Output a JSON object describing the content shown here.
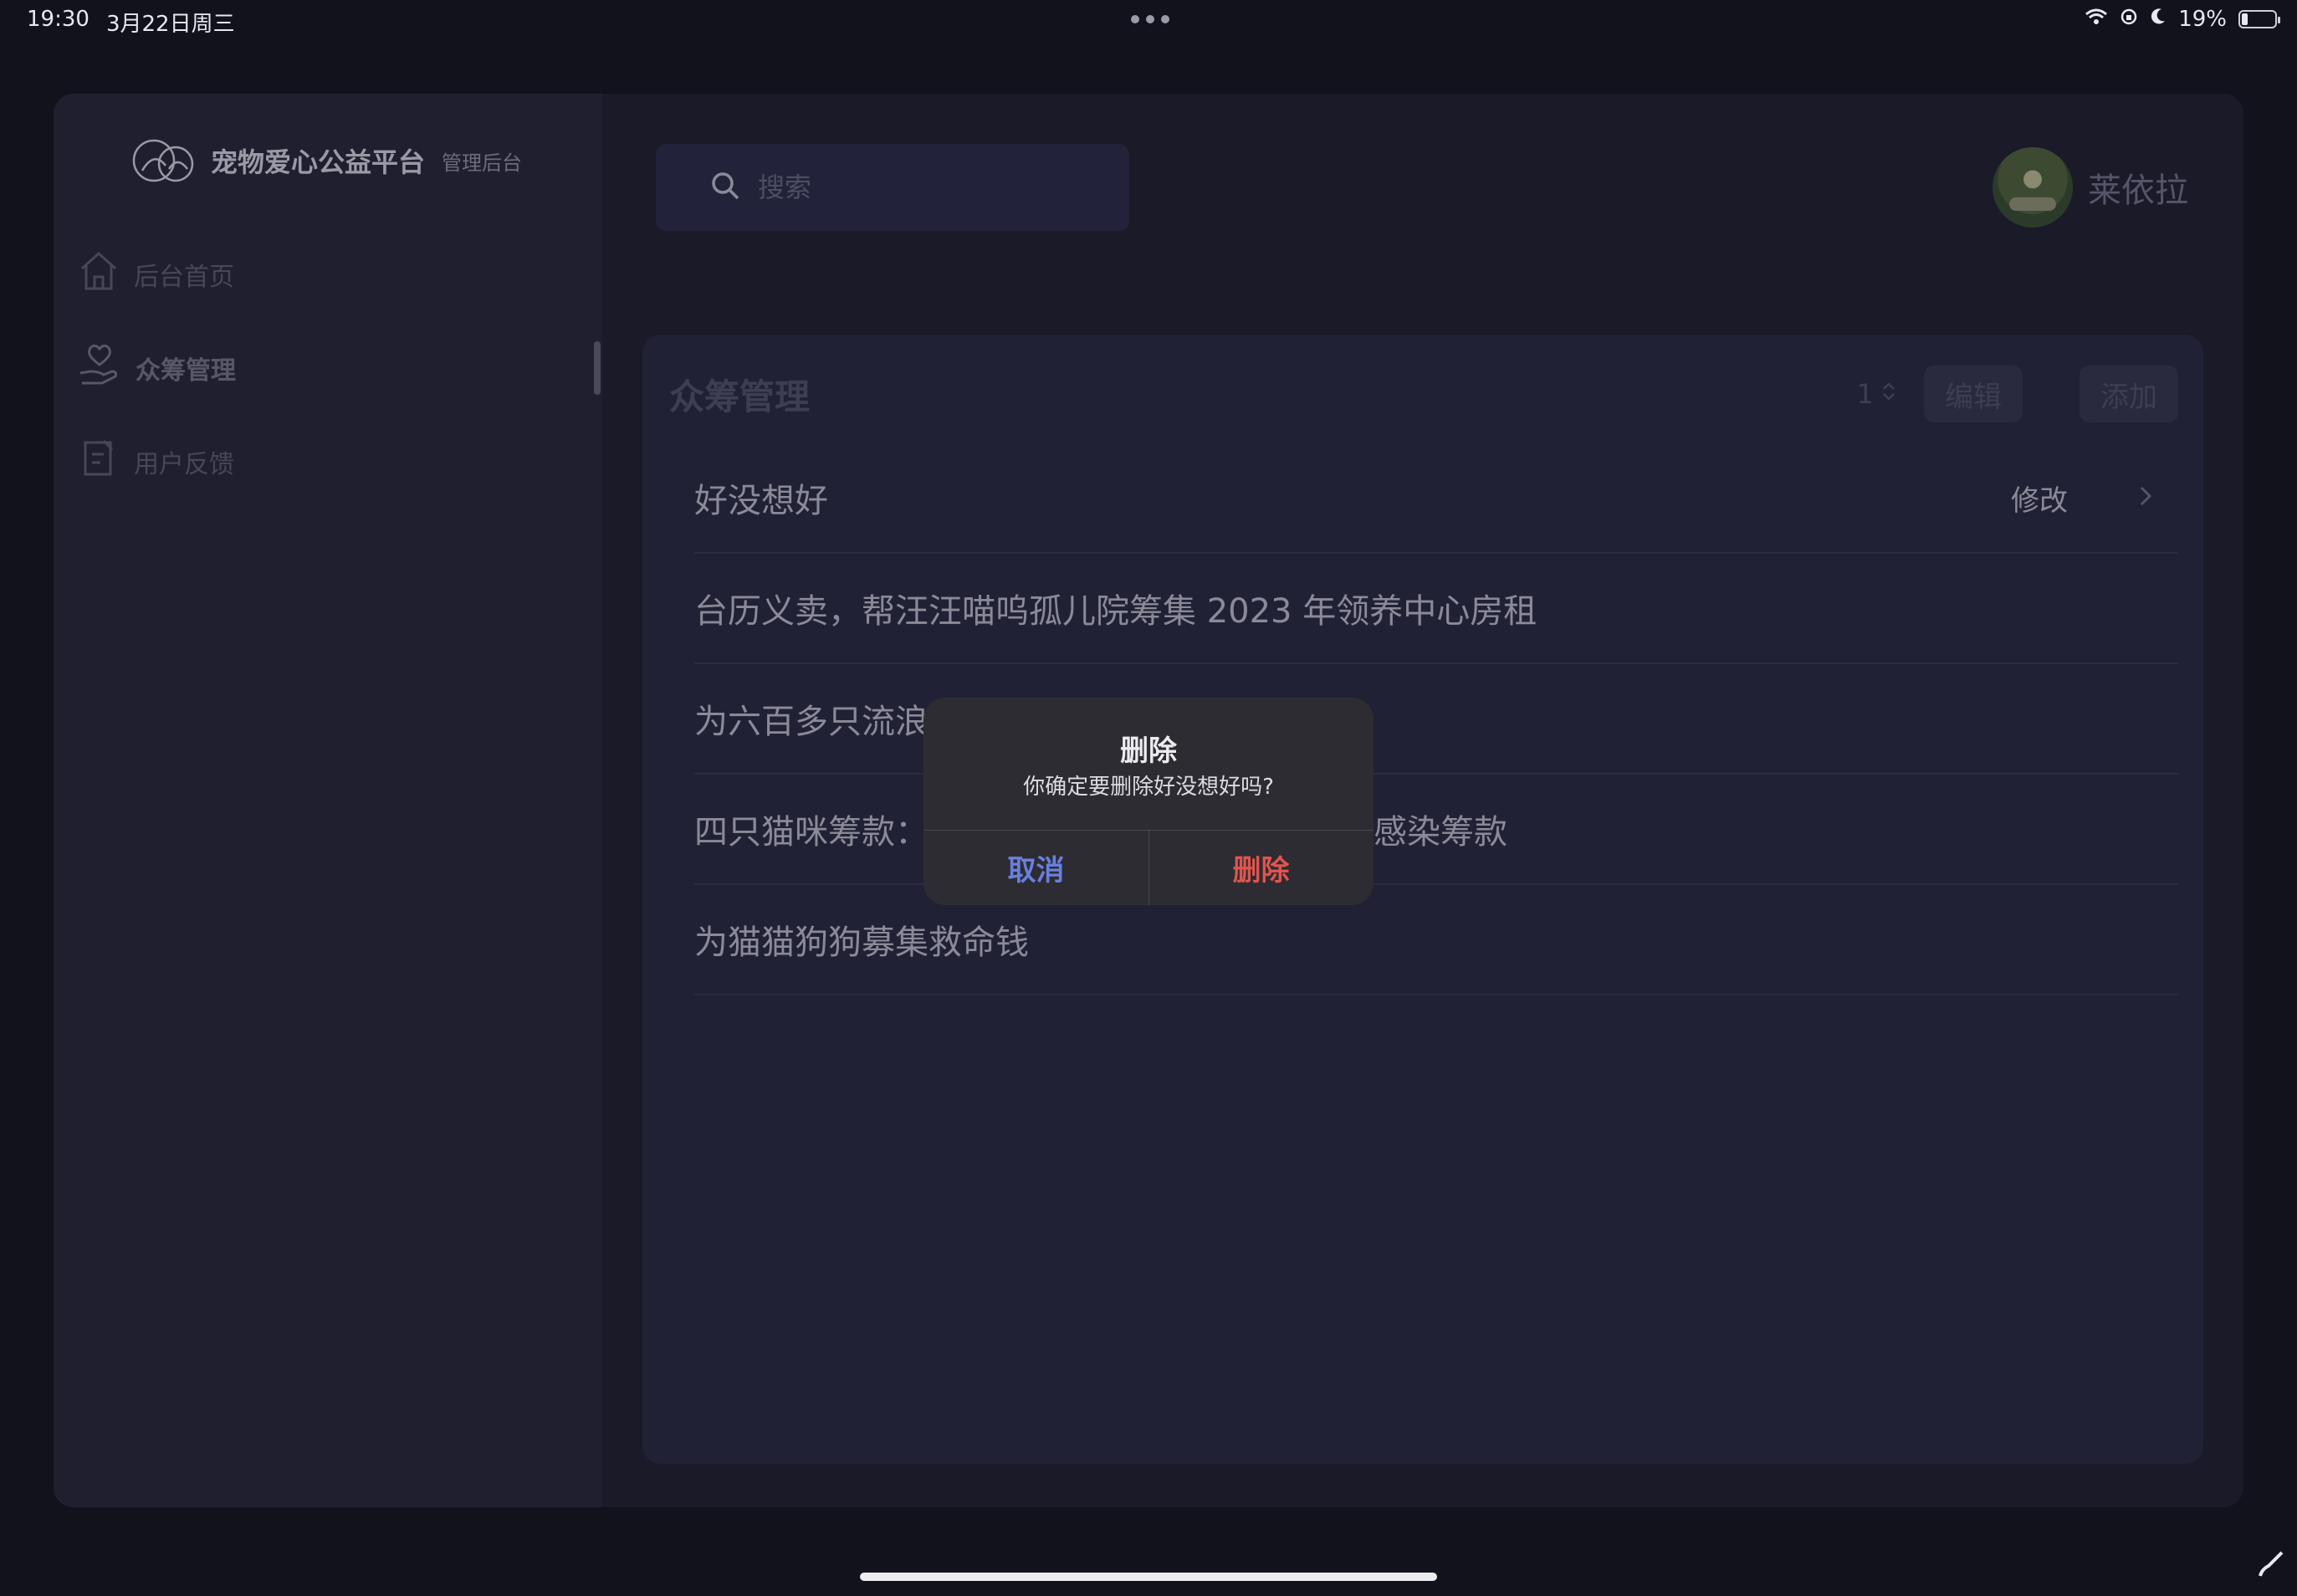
{
  "status_bar": {
    "time": "19:30",
    "date": "3月22日周三",
    "battery": "19%",
    "battery_level": 0.19
  },
  "sidebar": {
    "brand": {
      "name": "宠物爱心公益平台",
      "sub": "管理后台"
    },
    "items": [
      {
        "label": "后台首页",
        "icon": "home-icon"
      },
      {
        "label": "众筹管理",
        "icon": "heart-hand-icon",
        "active": true
      },
      {
        "label": "用户反馈",
        "icon": "feedback-icon"
      }
    ]
  },
  "header": {
    "search_placeholder": "搜索",
    "user_name": "莱依拉"
  },
  "content": {
    "title": "众筹管理",
    "page": "1",
    "edit_label": "编辑",
    "add_label": "添加",
    "rows": [
      {
        "title": "好没想好",
        "action": "修改"
      },
      {
        "title": "台历义卖，帮汪汪喵呜孤儿院筹集 2023 年领养中心房租"
      },
      {
        "title": "为六百多只流浪"
      },
      {
        "title": "四只猫咪筹款：",
        "tail": "感染筹款"
      },
      {
        "title": "为猫猫狗狗募集救命钱"
      }
    ]
  },
  "dialog": {
    "title": "删除",
    "message": "你确定要删除好没想好吗?",
    "cancel_label": "取消",
    "delete_label": "删除",
    "cancel_color": "#6a7fe0",
    "delete_color": "#e0544e"
  }
}
